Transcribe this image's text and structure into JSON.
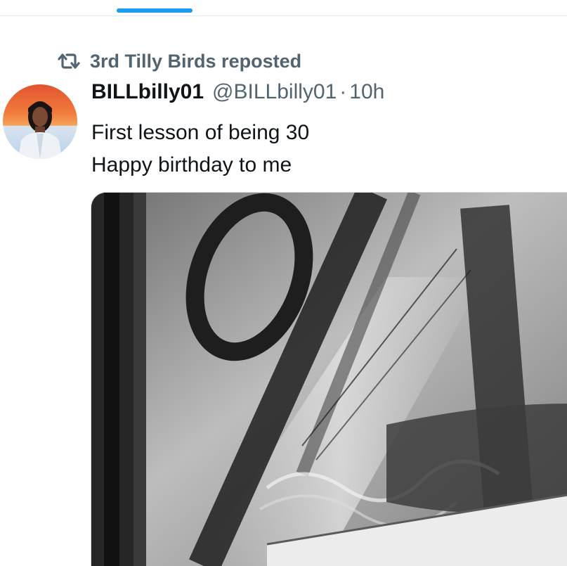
{
  "tabs": {
    "active_indicator_color": "#1d9bf0"
  },
  "repost": {
    "icon": "repost-icon",
    "text": "3rd Tilly Birds reposted"
  },
  "tweet": {
    "avatar_icon": "user-avatar",
    "display_name": "BILLbilly01",
    "handle": "@BILLbilly01",
    "separator": "·",
    "time": "10h",
    "text_lines": [
      "First lesson of being 30",
      "Happy birthday to me"
    ],
    "media": {
      "kind": "photo",
      "description_icon": "graffiti-photo"
    }
  },
  "colors": {
    "text_primary": "#0f1419",
    "text_secondary": "#536471",
    "accent": "#1d9bf0"
  }
}
